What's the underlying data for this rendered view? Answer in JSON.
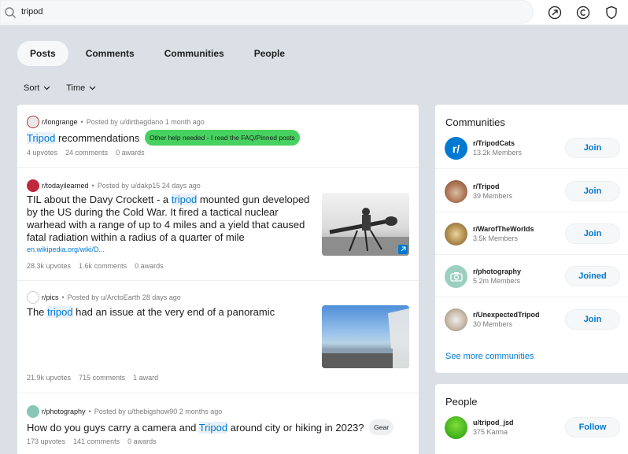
{
  "search": {
    "value": "tripod"
  },
  "tabs": [
    "Posts",
    "Comments",
    "Communities",
    "People"
  ],
  "filters": {
    "sort_label": "Sort",
    "time_label": "Time"
  },
  "posts": [
    {
      "subreddit": "r/longrange",
      "posted_by": "Posted by u/dirtbagdano 1 month ago",
      "title_pre": "",
      "title_hl": "Tripod",
      "title_post": " recommendations",
      "flair": "Other help needed - I read the FAQ/Pinned posts",
      "flair_bg": "#46d160",
      "upvotes": "4 upvotes",
      "comments": "24 comments",
      "awards": "0 awards"
    },
    {
      "subreddit": "r/todayilearned",
      "posted_by": "Posted by u/dakp15 24 days ago",
      "title_pre": "TIL about the Davy Crockett - a ",
      "title_hl": "tripod",
      "title_post": " mounted gun developed by the US during the Cold War. It fired a tactical nuclear warhead with a range of up to 4 miles and a yield that caused fatal radiation within a radius of a quarter of mile",
      "link": "en.wikipedia.org/wiki/D...",
      "upvotes": "28.3k upvotes",
      "comments": "1.6k comments",
      "awards": "0 awards"
    },
    {
      "subreddit": "r/pics",
      "posted_by": "Posted by u/ArctoEarth 28 days ago",
      "title_pre": "The ",
      "title_hl": "tripod",
      "title_post": " had an issue at the very end of a panoramic",
      "upvotes": "21.9k upvotes",
      "comments": "715 comments",
      "awards": "1 award"
    },
    {
      "subreddit": "r/photography",
      "posted_by": "Posted by u/thebigshow90 2 months ago",
      "title_pre": "How do you guys carry a camera and ",
      "title_hl": "Tripod",
      "title_post": " around city or hiking in 2023?",
      "flair": "Gear",
      "flair_bg": "#edeff1",
      "upvotes": "173 upvotes",
      "comments": "141 comments",
      "awards": "0 awards"
    }
  ],
  "communities": {
    "title": "Communities",
    "items": [
      {
        "name": "r/TripodCats",
        "members": "13.2k Members",
        "button": "Join"
      },
      {
        "name": "r/Tripod",
        "members": "39 Members",
        "button": "Join"
      },
      {
        "name": "r/WarofTheWorlds",
        "members": "3.5k Members",
        "button": "Join"
      },
      {
        "name": "r/photography",
        "members": "5.2m Members",
        "button": "Joined"
      },
      {
        "name": "r/UnexpectedTripod",
        "members": "30 Members",
        "button": "Join"
      }
    ],
    "see_more": "See more communities"
  },
  "people": {
    "title": "People",
    "items": [
      {
        "name": "u/tripod_jsd",
        "karma": "375 Karma",
        "button": "Follow"
      }
    ]
  },
  "colors": {
    "accent": "#0079d3",
    "background": "#dae0e6",
    "flair_green": "#46d160"
  }
}
